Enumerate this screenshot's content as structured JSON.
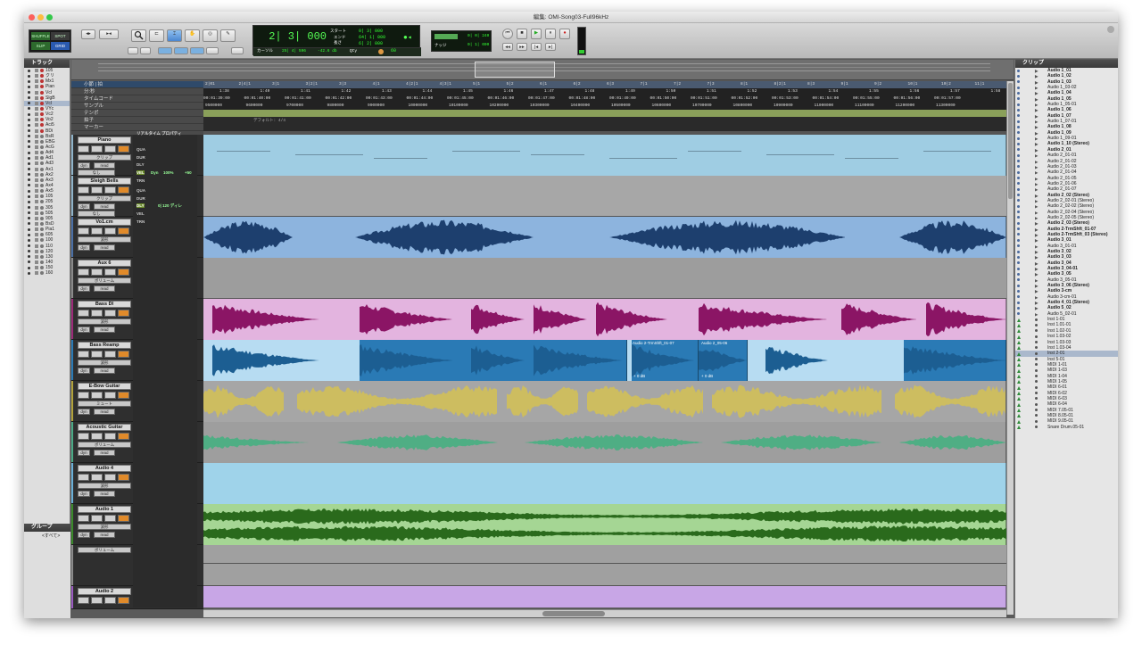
{
  "window": {
    "title": "編集: OMI-Song03-Full96kHz"
  },
  "toolbar": {
    "modes": [
      "SHUFFLE",
      "SPOT",
      "SLIP",
      "GRID"
    ],
    "main_counter": "2| 3| 000",
    "cursor_label": "カーソル",
    "cursor_value": "25| 4| 596",
    "cursor_db": "-42.6 db",
    "start_label": "スタート",
    "end_label": "エンド",
    "length_label": "長さ",
    "start_value": "0| 3| 000",
    "end_value": "64| 1| 000",
    "length_value": "6| 2| 000",
    "nudge_value": "0| 0| 240",
    "grid_value": "0| 1| 000",
    "nudge_label": "ナッジ",
    "tempo_value": "60",
    "qty_label": "Qty"
  },
  "left_panel": {
    "tracks_title": "トラック",
    "tracks": [
      "105",
      "クリ",
      "Mx1",
      "Pian",
      "Vcl",
      "SlgB",
      "Vcl",
      "VYc",
      "Vc2",
      "Vo2",
      "Aci5",
      "BDi",
      "BsR",
      "EBG",
      "AcG",
      "Ad4",
      "Ad1",
      "Ad3",
      "Ax1",
      "Ax2",
      "Ax3",
      "Ax4",
      "Ax5",
      "105",
      "205",
      "305",
      "505",
      "905",
      "BsD",
      "Pia1",
      "605",
      "100",
      "110",
      "120",
      "130",
      "140",
      "150",
      "160"
    ],
    "groups_title": "グループ",
    "groups_all": "<すべて>"
  },
  "rulers": {
    "labels": [
      "小節 | 拍",
      "分:秒",
      "タイムコード",
      "サンプル",
      "テンポ",
      "拍子",
      "マーカー"
    ],
    "bars": [
      "2|01",
      "2|4|1",
      "3|1",
      "3|2|1",
      "3|3",
      "4|1",
      "4|2|1",
      "4|3|1",
      "5|1",
      "5|2",
      "6|1",
      "6|2",
      "6|3",
      "7|1",
      "7|2",
      "7|3",
      "8|1",
      "8|2|1",
      "8|3",
      "9|1",
      "9|2",
      "10|1",
      "10|2",
      "11|1"
    ],
    "minsec": [
      "1:38",
      "1:40",
      "1:41",
      "1:42",
      "1:43",
      "1:44",
      "1:45",
      "1:46",
      "1:47",
      "1:48",
      "1:49",
      "1:50",
      "1:51",
      "1:52",
      "1:53",
      "1:54",
      "1:55",
      "1:56",
      "1:57",
      "1:58"
    ],
    "timecode": [
      "00:01:39:00",
      "00:01:40:00",
      "00:01:41:00",
      "00:01:42:00",
      "00:01:43:00",
      "00:01:44:00",
      "00:01:45:00",
      "00:01:46:00",
      "00:01:47:00",
      "00:01:48:00",
      "00:01:49:00",
      "00:01:50:00",
      "00:01:51:00",
      "00:01:52:00",
      "00:01:53:00",
      "00:01:54:00",
      "00:01:55:00",
      "00:01:56:00",
      "00:01:57:00"
    ],
    "samples": [
      "9500000",
      "9600000",
      "9700000",
      "9800000",
      "9900000",
      "10000000",
      "10100000",
      "10200000",
      "10300000",
      "10400000",
      "10500000",
      "10600000",
      "10700000",
      "10800000",
      "10900000",
      "11000000",
      "11100000",
      "11200000",
      "11300000"
    ],
    "meter": "デフォルト: 4/4",
    "realtime": "リアルタイム プロパティ"
  },
  "midi_props": {
    "qua": "QUA",
    "dur": "DUR",
    "dly": "DLY",
    "vel": "VEL",
    "trn": "TRN",
    "dyn": "Dyn",
    "vel_pct": "100%",
    "vel_off": "+50",
    "dly_val": "0| 120 ディレ"
  },
  "track_headers": [
    {
      "name": "Piano",
      "sub": "クリップ",
      "v1": "dyn",
      "v2": "read",
      "v3": "なし",
      "color": "#8fb3c9"
    },
    {
      "name": "Sleigh Bells",
      "sub": "クリップ",
      "v1": "dyn",
      "v2": "read",
      "v3": "なし",
      "color": "#8fb3c9"
    },
    {
      "name": "Vo1.cm",
      "sub": "波形",
      "v1": "dyn",
      "v2": "read",
      "color": "#4a6fa5"
    },
    {
      "name": "Aux 6",
      "sub": "ボリューム",
      "v1": "dyn",
      "v2": "read",
      "color": "#8a8a8a"
    },
    {
      "name": "Bass DI",
      "sub": "波形",
      "v1": "dyn",
      "v2": "read",
      "color": "#9c2a78"
    },
    {
      "name": "Bass Reamp",
      "sub": "波形",
      "v1": "dyn",
      "v2": "read",
      "color": "#2a7ab5"
    },
    {
      "name": "E-Bow Guitar",
      "sub": "ミュート",
      "v1": "dyn",
      "v2": "read",
      "color": "#b2a23a"
    },
    {
      "name": "Acoustic Guitar",
      "sub": "ボリューム",
      "v1": "dyn",
      "v2": "read",
      "color": "#4aaa86"
    },
    {
      "name": "Audio 4",
      "sub": "波形",
      "v1": "dyn",
      "v2": "read",
      "color": "#6ab0d8"
    },
    {
      "name": "Audio 1",
      "sub": "波形",
      "v1": "dyn",
      "v2": "read",
      "color": "#3a8a2a"
    },
    {
      "name": "",
      "sub": "ボリューム",
      "color": "#8a8a8a"
    },
    {
      "name": "Audio 2",
      "sub": "",
      "v1": "",
      "v2": "",
      "color": "#9a5ac0"
    }
  ],
  "clip_labels": {
    "bass_reamp_1": "Audio 2-TrmShft_01-07",
    "bass_reamp_2": "Audio 2_05-06",
    "gain1": "+ 0 dB",
    "gain2": "+ 0 dB"
  },
  "clips_panel": {
    "title": "クリップ",
    "items": [
      {
        "t": "Audio 1_01",
        "b": true
      },
      {
        "t": "Audio 1_02",
        "b": true
      },
      {
        "t": "Audio 1_03",
        "b": true
      },
      {
        "t": "Audio 1_03-02",
        "b": false
      },
      {
        "t": "Audio 1_04",
        "b": true
      },
      {
        "t": "Audio 1_05",
        "b": true
      },
      {
        "t": "Audio 1_05-01",
        "b": false
      },
      {
        "t": "Audio 1_06",
        "b": true
      },
      {
        "t": "Audio 1_07",
        "b": true
      },
      {
        "t": "Audio 1_07-01",
        "b": false
      },
      {
        "t": "Audio 1_08",
        "b": true
      },
      {
        "t": "Audio 1_09",
        "b": true
      },
      {
        "t": "Audio 1_09-01",
        "b": false
      },
      {
        "t": "Audio 1_10 (Stereo)",
        "b": true
      },
      {
        "t": "Audio 2_01",
        "b": true
      },
      {
        "t": "Audio 2_01-01",
        "b": false
      },
      {
        "t": "Audio 2_01-02",
        "b": false
      },
      {
        "t": "Audio 2_01-03",
        "b": false
      },
      {
        "t": "Audio 2_01-04",
        "b": false
      },
      {
        "t": "Audio 2_01-05",
        "b": false
      },
      {
        "t": "Audio 2_01-06",
        "b": false
      },
      {
        "t": "Audio 2_01-07",
        "b": false
      },
      {
        "t": "Audio 2_02 (Stereo)",
        "b": true
      },
      {
        "t": "Audio 2_02-01 (Stereo)",
        "b": false
      },
      {
        "t": "Audio 2_02-02 (Stereo)",
        "b": false
      },
      {
        "t": "Audio 2_02-04 (Stereo)",
        "b": false
      },
      {
        "t": "Audio 2_02-05 (Stereo)",
        "b": false
      },
      {
        "t": "Audio 2_03 (Stereo)",
        "b": true
      },
      {
        "t": "Audio 2-TrmShft_01-07",
        "b": true
      },
      {
        "t": "Audio 2-TrmShft_03 (Stereo)",
        "b": true
      },
      {
        "t": "Audio 3_01",
        "b": true
      },
      {
        "t": "Audio 3_01-01",
        "b": false
      },
      {
        "t": "Audio 3_02",
        "b": true
      },
      {
        "t": "Audio 3_03",
        "b": true
      },
      {
        "t": "Audio 3_04",
        "b": true
      },
      {
        "t": "Audio 3_04-01",
        "b": true
      },
      {
        "t": "Audio 3_05",
        "b": true
      },
      {
        "t": "Audio 3_05-01",
        "b": false
      },
      {
        "t": "Audio 3_06 (Stereo)",
        "b": true
      },
      {
        "t": "Audio 3-cm",
        "b": true
      },
      {
        "t": "Audio 3-cm-01",
        "b": false
      },
      {
        "t": "Audio 4_01 (Stereo)",
        "b": true
      },
      {
        "t": "Audio 5_02",
        "b": true
      },
      {
        "t": "Audio 5_02-01",
        "b": false
      },
      {
        "t": "Inst 1-01",
        "b": false
      },
      {
        "t": "Inst 1.01-01",
        "b": false
      },
      {
        "t": "Inst 1.02-01",
        "b": false
      },
      {
        "t": "Inst 1.03-02",
        "b": false
      },
      {
        "t": "Inst 1.03-03",
        "b": false
      },
      {
        "t": "Inst 1.03-04",
        "b": false
      },
      {
        "t": "Inst 2-01",
        "b": false
      },
      {
        "t": "Inst 5-01",
        "b": false
      },
      {
        "t": "MIDI 1-01",
        "b": false
      },
      {
        "t": "MIDI 1-03",
        "b": false
      },
      {
        "t": "MIDI 1-04",
        "b": false
      },
      {
        "t": "MIDI 1-05",
        "b": false
      },
      {
        "t": "MIDI 6-01",
        "b": false
      },
      {
        "t": "MIDI 6-02",
        "b": false
      },
      {
        "t": "MIDI 6-03",
        "b": false
      },
      {
        "t": "MIDI 6-04",
        "b": false
      },
      {
        "t": "MIDI 7.05-01",
        "b": false
      },
      {
        "t": "MIDI 8.05-01",
        "b": false
      },
      {
        "t": "MIDI 9.05-01",
        "b": false
      },
      {
        "t": "Snare Drum.05-01",
        "b": false
      }
    ]
  }
}
